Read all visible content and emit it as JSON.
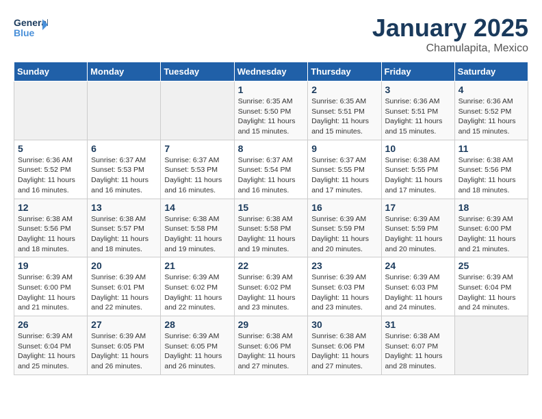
{
  "logo": {
    "text_general": "General",
    "text_blue": "Blue",
    "arrow_symbol": "▶"
  },
  "header": {
    "month": "January 2025",
    "location": "Chamulapita, Mexico"
  },
  "weekdays": [
    "Sunday",
    "Monday",
    "Tuesday",
    "Wednesday",
    "Thursday",
    "Friday",
    "Saturday"
  ],
  "weeks": [
    [
      {
        "day": "",
        "info": ""
      },
      {
        "day": "",
        "info": ""
      },
      {
        "day": "",
        "info": ""
      },
      {
        "day": "1",
        "info": "Sunrise: 6:35 AM\nSunset: 5:50 PM\nDaylight: 11 hours\nand 15 minutes."
      },
      {
        "day": "2",
        "info": "Sunrise: 6:35 AM\nSunset: 5:51 PM\nDaylight: 11 hours\nand 15 minutes."
      },
      {
        "day": "3",
        "info": "Sunrise: 6:36 AM\nSunset: 5:51 PM\nDaylight: 11 hours\nand 15 minutes."
      },
      {
        "day": "4",
        "info": "Sunrise: 6:36 AM\nSunset: 5:52 PM\nDaylight: 11 hours\nand 15 minutes."
      }
    ],
    [
      {
        "day": "5",
        "info": "Sunrise: 6:36 AM\nSunset: 5:52 PM\nDaylight: 11 hours\nand 16 minutes."
      },
      {
        "day": "6",
        "info": "Sunrise: 6:37 AM\nSunset: 5:53 PM\nDaylight: 11 hours\nand 16 minutes."
      },
      {
        "day": "7",
        "info": "Sunrise: 6:37 AM\nSunset: 5:53 PM\nDaylight: 11 hours\nand 16 minutes."
      },
      {
        "day": "8",
        "info": "Sunrise: 6:37 AM\nSunset: 5:54 PM\nDaylight: 11 hours\nand 16 minutes."
      },
      {
        "day": "9",
        "info": "Sunrise: 6:37 AM\nSunset: 5:55 PM\nDaylight: 11 hours\nand 17 minutes."
      },
      {
        "day": "10",
        "info": "Sunrise: 6:38 AM\nSunset: 5:55 PM\nDaylight: 11 hours\nand 17 minutes."
      },
      {
        "day": "11",
        "info": "Sunrise: 6:38 AM\nSunset: 5:56 PM\nDaylight: 11 hours\nand 18 minutes."
      }
    ],
    [
      {
        "day": "12",
        "info": "Sunrise: 6:38 AM\nSunset: 5:56 PM\nDaylight: 11 hours\nand 18 minutes."
      },
      {
        "day": "13",
        "info": "Sunrise: 6:38 AM\nSunset: 5:57 PM\nDaylight: 11 hours\nand 18 minutes."
      },
      {
        "day": "14",
        "info": "Sunrise: 6:38 AM\nSunset: 5:58 PM\nDaylight: 11 hours\nand 19 minutes."
      },
      {
        "day": "15",
        "info": "Sunrise: 6:38 AM\nSunset: 5:58 PM\nDaylight: 11 hours\nand 19 minutes."
      },
      {
        "day": "16",
        "info": "Sunrise: 6:39 AM\nSunset: 5:59 PM\nDaylight: 11 hours\nand 20 minutes."
      },
      {
        "day": "17",
        "info": "Sunrise: 6:39 AM\nSunset: 5:59 PM\nDaylight: 11 hours\nand 20 minutes."
      },
      {
        "day": "18",
        "info": "Sunrise: 6:39 AM\nSunset: 6:00 PM\nDaylight: 11 hours\nand 21 minutes."
      }
    ],
    [
      {
        "day": "19",
        "info": "Sunrise: 6:39 AM\nSunset: 6:00 PM\nDaylight: 11 hours\nand 21 minutes."
      },
      {
        "day": "20",
        "info": "Sunrise: 6:39 AM\nSunset: 6:01 PM\nDaylight: 11 hours\nand 22 minutes."
      },
      {
        "day": "21",
        "info": "Sunrise: 6:39 AM\nSunset: 6:02 PM\nDaylight: 11 hours\nand 22 minutes."
      },
      {
        "day": "22",
        "info": "Sunrise: 6:39 AM\nSunset: 6:02 PM\nDaylight: 11 hours\nand 23 minutes."
      },
      {
        "day": "23",
        "info": "Sunrise: 6:39 AM\nSunset: 6:03 PM\nDaylight: 11 hours\nand 23 minutes."
      },
      {
        "day": "24",
        "info": "Sunrise: 6:39 AM\nSunset: 6:03 PM\nDaylight: 11 hours\nand 24 minutes."
      },
      {
        "day": "25",
        "info": "Sunrise: 6:39 AM\nSunset: 6:04 PM\nDaylight: 11 hours\nand 24 minutes."
      }
    ],
    [
      {
        "day": "26",
        "info": "Sunrise: 6:39 AM\nSunset: 6:04 PM\nDaylight: 11 hours\nand 25 minutes."
      },
      {
        "day": "27",
        "info": "Sunrise: 6:39 AM\nSunset: 6:05 PM\nDaylight: 11 hours\nand 26 minutes."
      },
      {
        "day": "28",
        "info": "Sunrise: 6:39 AM\nSunset: 6:05 PM\nDaylight: 11 hours\nand 26 minutes."
      },
      {
        "day": "29",
        "info": "Sunrise: 6:38 AM\nSunset: 6:06 PM\nDaylight: 11 hours\nand 27 minutes."
      },
      {
        "day": "30",
        "info": "Sunrise: 6:38 AM\nSunset: 6:06 PM\nDaylight: 11 hours\nand 27 minutes."
      },
      {
        "day": "31",
        "info": "Sunrise: 6:38 AM\nSunset: 6:07 PM\nDaylight: 11 hours\nand 28 minutes."
      },
      {
        "day": "",
        "info": ""
      }
    ]
  ]
}
